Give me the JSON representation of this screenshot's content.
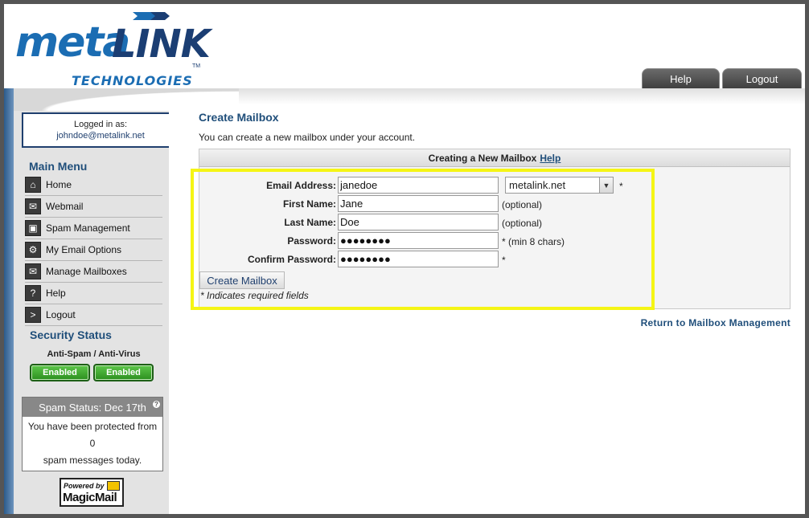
{
  "brand": {
    "logo_main": "meta",
    "logo_accent": "LINK",
    "logo_tm": "TM",
    "logo_sub": "TECHNOLOGIES"
  },
  "top_nav": {
    "help": "Help",
    "logout": "Logout"
  },
  "sidebar": {
    "logged_in_label": "Logged in as:",
    "user_email": "johndoe@metalink.net",
    "menu_title": "Main Menu",
    "menu_items": [
      {
        "label": "Home",
        "icon": "home-icon"
      },
      {
        "label": "Webmail",
        "icon": "envelope-icon"
      },
      {
        "label": "Spam Management",
        "icon": "lock-icon"
      },
      {
        "label": "My Email Options",
        "icon": "gear-icon"
      },
      {
        "label": "Manage Mailboxes",
        "icon": "mailbox-icon"
      },
      {
        "label": "Help",
        "icon": "question-icon"
      },
      {
        "label": "Logout",
        "icon": "arrow-right-icon"
      }
    ],
    "security_title": "Security Status",
    "security_sub": "Anti-Spam / Anti-Virus",
    "antispam_status": "Enabled",
    "antivirus_status": "Enabled",
    "spam_status_title": "Spam Status: Dec 17th",
    "spam_line1": "You have been protected from",
    "spam_count": "0",
    "spam_line2": "spam messages today.",
    "powered_by": "Powered by",
    "powered_brand": "MagicMail"
  },
  "main": {
    "title": "Create Mailbox",
    "description": "You can create a new mailbox under your account.",
    "panel_title": "Creating a New Mailbox",
    "panel_help": "Help",
    "form": {
      "email_label": "Email Address:",
      "email_value": "janedoe",
      "email_required": "*",
      "domain_value": "metalink.net",
      "first_label": "First Name:",
      "first_value": "Jane",
      "first_note": "(optional)",
      "last_label": "Last Name:",
      "last_value": "Doe",
      "last_note": "(optional)",
      "password_label": "Password:",
      "password_value": "●●●●●●●●",
      "password_note": "* (min 8 chars)",
      "confirm_label": "Confirm Password:",
      "confirm_value": "●●●●●●●●",
      "confirm_required": "*"
    },
    "submit_label": "Create Mailbox",
    "required_note": "* Indicates required fields",
    "return_link": "Return to Mailbox Management"
  },
  "colors": {
    "accent_blue": "#1f4e7a",
    "brand_blue": "#1b6db3",
    "highlight": "#f5f515",
    "enabled_green": "#2c8f1f"
  }
}
